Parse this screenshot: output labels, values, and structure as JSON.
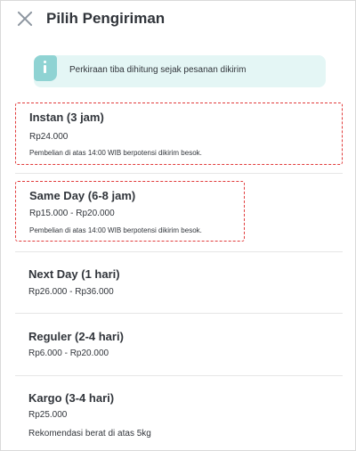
{
  "header": {
    "title": "Pilih Pengiriman",
    "close_icon": "close-icon"
  },
  "info": {
    "icon": "info-icon",
    "text": "Perkiraan tiba dihitung sejak pesanan dikirim"
  },
  "options": [
    {
      "name": "Instan (3 jam)",
      "price": "Rp24.000",
      "note": "Pembelian di atas 14:00 WIB berpotensi dikirim besok."
    },
    {
      "name": "Same Day (6-8 jam)",
      "price": "Rp15.000 - Rp20.000",
      "note": "Pembelian di atas 14:00 WIB berpotensi dikirim besok."
    },
    {
      "name": "Next Day (1 hari)",
      "price": "Rp26.000 - Rp36.000"
    },
    {
      "name": "Reguler (2-4 hari)",
      "price": "Rp6.000 - Rp20.000"
    },
    {
      "name": "Kargo (3-4 hari)",
      "price": "Rp25.000",
      "note": "Rekomendasi berat di atas 5kg"
    }
  ],
  "colors": {
    "highlight_border": "#e13b3b",
    "info_background": "#e4f6f5",
    "info_badge": "#8fd3d3"
  }
}
